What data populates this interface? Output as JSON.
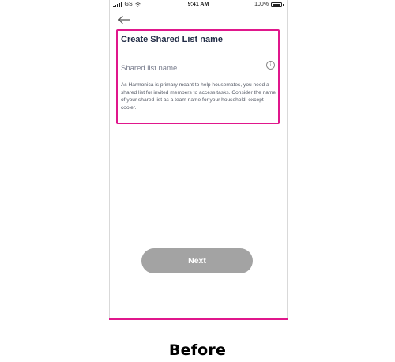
{
  "status_bar": {
    "carrier": "GS",
    "time": "9:41 AM",
    "battery": "100%"
  },
  "header": {
    "back_icon": "arrow-left-icon"
  },
  "form": {
    "title": "Create Shared List name",
    "input": {
      "placeholder": "Shared list name",
      "value": ""
    },
    "info_icon": "info-icon",
    "helper_text": "As Harmonica is primary meant to help housemates, you need a shared list for invited members to access tasks. Consider the name of your shared list as a team name for your household, except cooler."
  },
  "actions": {
    "next_label": "Next"
  },
  "caption": "Before",
  "colors": {
    "highlight": "#e0178c",
    "button_disabled": "#a3a3a3",
    "title_text": "#1f2a44"
  }
}
